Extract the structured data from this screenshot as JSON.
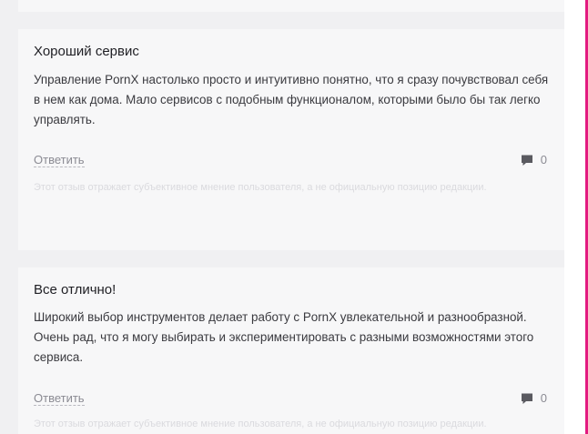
{
  "reviews": [
    {
      "title": "Хороший сервис",
      "text": "Управление PornX настолько просто и интуитивно понятно, что я сразу почувствовал себя в нем как дома. Мало сервисов с подобным функционалом, которыми было бы так легко управлять.",
      "reply_label": "Ответить",
      "comment_count": "0",
      "disclaimer": "Этот отзыв отражает субъективное мнение пользователя, а не официальную позицию редакции."
    },
    {
      "title": "Все отлично!",
      "text": "Широкий выбор инструментов делает работу с PornX увлекательной и разнообразной. Очень рад, что я могу выбирать и экспериментировать с разными возможностями этого сервиса.",
      "reply_label": "Ответить",
      "comment_count": "0",
      "disclaimer": "Этот отзыв отражает субъективное мнение пользователя, а не официальную позицию редакции."
    }
  ],
  "icons": {
    "comment": "speech-bubble-icon"
  },
  "colors": {
    "accent_edge": "#e21a80",
    "card_bg": "#f7f7f8",
    "page_bg": "#f0f0f2"
  }
}
